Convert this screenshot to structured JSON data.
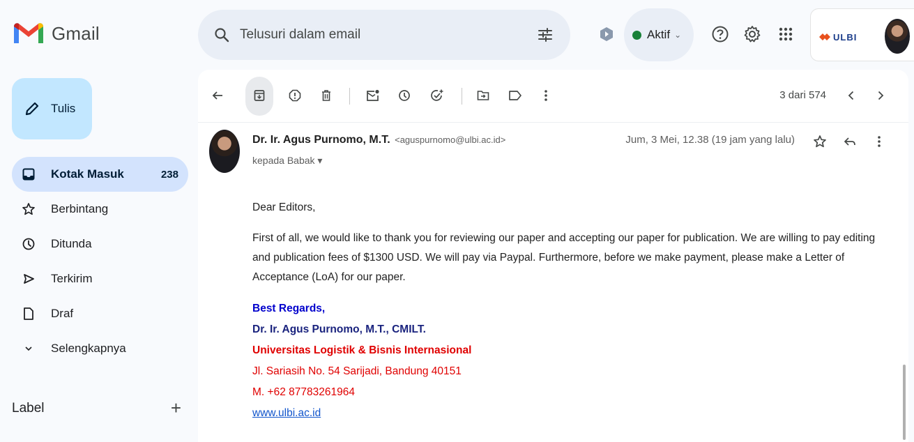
{
  "app": {
    "name": "Gmail"
  },
  "search": {
    "placeholder": "Telusuri dalam email"
  },
  "status": {
    "label": "Aktif"
  },
  "account": {
    "org_logo_text": "ULBI"
  },
  "compose": {
    "label": "Tulis"
  },
  "sidebar": {
    "items": [
      {
        "label": "Kotak Masuk",
        "count": "238",
        "icon": "inbox-icon",
        "active": true
      },
      {
        "label": "Berbintang",
        "icon": "star-icon"
      },
      {
        "label": "Ditunda",
        "icon": "clock-icon"
      },
      {
        "label": "Terkirim",
        "icon": "send-icon"
      },
      {
        "label": "Draf",
        "icon": "draft-icon"
      },
      {
        "label": "Selengkapnya",
        "icon": "chevron-down-icon"
      }
    ],
    "label_header": "Label"
  },
  "toolbar": {
    "pager": "3 dari 574"
  },
  "message": {
    "sender_name": "Dr. Ir. Agus Purnomo, M.T.",
    "sender_email": "<aguspurnomo@ulbi.ac.id>",
    "to_line": "kepada Babak",
    "date": "Jum, 3 Mei, 12.38 (19 jam yang lalu)",
    "greeting": "Dear Editors,",
    "paragraph": "First of all, we would like to thank you for reviewing our paper and accepting our paper for publication. We are willing to pay editing and publication fees of $1300 USD. We will pay via Paypal. Furthermore, before we make payment, please make a Letter of Acceptance (LoA) for our paper.",
    "signature": {
      "closing": "Best Regards,",
      "name": "Dr. Ir. Agus Purnomo, M.T., CMILT.",
      "org": "Universitas Logistik & Bisnis Internasional",
      "address": "Jl. Sariasih No. 54 Sarijadi, Bandung 40151",
      "phone": "M. +62 87783261964",
      "website": "www.ulbi.ac.id"
    }
  },
  "colors": {
    "compose_bg": "#c2e7ff",
    "active_nav_bg": "#d3e3fd",
    "search_bg": "#e9eef6",
    "status_dot": "#188038",
    "signature_blue": "#0000cc",
    "signature_red": "#e00000",
    "link": "#1155cc"
  }
}
